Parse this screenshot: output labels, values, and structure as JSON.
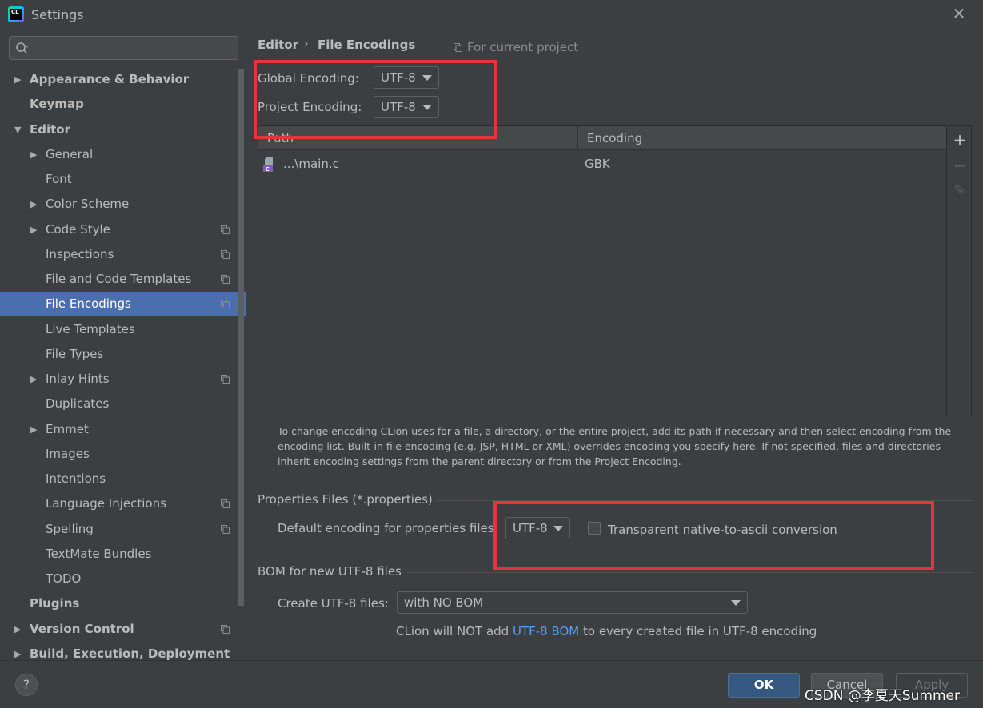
{
  "window": {
    "title": "Settings",
    "app_icon_text": "CL",
    "close_glyph": "✕"
  },
  "search": {
    "value": "",
    "placeholder": ""
  },
  "sidebar": {
    "items": [
      {
        "label": "Appearance & Behavior",
        "level": 0,
        "bold": true,
        "expandable": true,
        "expanded": false,
        "project_icon": false,
        "selected": false
      },
      {
        "label": "Keymap",
        "level": 0,
        "bold": true,
        "expandable": false,
        "project_icon": false,
        "selected": false
      },
      {
        "label": "Editor",
        "level": 0,
        "bold": true,
        "expandable": true,
        "expanded": true,
        "project_icon": false,
        "selected": false
      },
      {
        "label": "General",
        "level": 1,
        "bold": false,
        "expandable": true,
        "expanded": false,
        "project_icon": false,
        "selected": false
      },
      {
        "label": "Font",
        "level": 1,
        "bold": false,
        "expandable": false,
        "project_icon": false,
        "selected": false
      },
      {
        "label": "Color Scheme",
        "level": 1,
        "bold": false,
        "expandable": true,
        "expanded": false,
        "project_icon": false,
        "selected": false
      },
      {
        "label": "Code Style",
        "level": 1,
        "bold": false,
        "expandable": true,
        "expanded": false,
        "project_icon": true,
        "selected": false
      },
      {
        "label": "Inspections",
        "level": 1,
        "bold": false,
        "expandable": false,
        "project_icon": true,
        "selected": false
      },
      {
        "label": "File and Code Templates",
        "level": 1,
        "bold": false,
        "expandable": false,
        "project_icon": true,
        "selected": false
      },
      {
        "label": "File Encodings",
        "level": 1,
        "bold": false,
        "expandable": false,
        "project_icon": true,
        "selected": true
      },
      {
        "label": "Live Templates",
        "level": 1,
        "bold": false,
        "expandable": false,
        "project_icon": false,
        "selected": false
      },
      {
        "label": "File Types",
        "level": 1,
        "bold": false,
        "expandable": false,
        "project_icon": false,
        "selected": false
      },
      {
        "label": "Inlay Hints",
        "level": 1,
        "bold": false,
        "expandable": true,
        "expanded": false,
        "project_icon": true,
        "selected": false
      },
      {
        "label": "Duplicates",
        "level": 1,
        "bold": false,
        "expandable": false,
        "project_icon": false,
        "selected": false
      },
      {
        "label": "Emmet",
        "level": 1,
        "bold": false,
        "expandable": true,
        "expanded": false,
        "project_icon": false,
        "selected": false
      },
      {
        "label": "Images",
        "level": 1,
        "bold": false,
        "expandable": false,
        "project_icon": false,
        "selected": false
      },
      {
        "label": "Intentions",
        "level": 1,
        "bold": false,
        "expandable": false,
        "project_icon": false,
        "selected": false
      },
      {
        "label": "Language Injections",
        "level": 1,
        "bold": false,
        "expandable": false,
        "project_icon": true,
        "selected": false
      },
      {
        "label": "Spelling",
        "level": 1,
        "bold": false,
        "expandable": false,
        "project_icon": true,
        "selected": false
      },
      {
        "label": "TextMate Bundles",
        "level": 1,
        "bold": false,
        "expandable": false,
        "project_icon": false,
        "selected": false
      },
      {
        "label": "TODO",
        "level": 1,
        "bold": false,
        "expandable": false,
        "project_icon": false,
        "selected": false
      },
      {
        "label": "Plugins",
        "level": 0,
        "bold": true,
        "expandable": false,
        "project_icon": false,
        "selected": false
      },
      {
        "label": "Version Control",
        "level": 0,
        "bold": true,
        "expandable": true,
        "expanded": false,
        "project_icon": true,
        "selected": false
      },
      {
        "label": "Build, Execution, Deployment",
        "level": 0,
        "bold": true,
        "expandable": true,
        "expanded": false,
        "project_icon": false,
        "selected": false
      }
    ]
  },
  "breadcrumb": {
    "parent": "Editor",
    "separator": "›",
    "current": "File Encodings",
    "scope": "For current project"
  },
  "encodings": {
    "global_label": "Global Encoding:",
    "global_value": "UTF-8",
    "project_label": "Project Encoding:",
    "project_value": "UTF-8"
  },
  "table": {
    "columns": [
      "Path",
      "Encoding"
    ],
    "rows": [
      {
        "path": "...\\main.c",
        "encoding": "GBK"
      }
    ],
    "toolbar": {
      "add": "+",
      "remove": "−",
      "edit": "✎"
    }
  },
  "help_text": "To change encoding CLion uses for a file, a directory, or the entire project, add its path if necessary and then select encoding from the encoding list. Built-in file encoding (e.g. JSP, HTML or XML) overrides encoding you specify here. If not specified, files and directories inherit encoding settings from the parent directory or from the Project Encoding.",
  "properties": {
    "section_title": "Properties Files (*.properties)",
    "default_label": "Default encoding for properties files:",
    "default_value": "UTF-8",
    "transparent_label": "Transparent native-to-ascii conversion",
    "transparent_checked": false
  },
  "bom": {
    "section_title": "BOM for new UTF-8 files",
    "create_label": "Create UTF-8 files:",
    "create_value": "with NO BOM",
    "note_prefix": "CLion will NOT add ",
    "note_link": "UTF-8 BOM",
    "note_suffix": " to every created file in UTF-8 encoding"
  },
  "buttons": {
    "help": "?",
    "ok": "OK",
    "cancel": "Cancel",
    "apply": "Apply"
  },
  "watermark": "CSDN @李夏天Summer",
  "colors": {
    "background": "#3c3f41",
    "selection": "#4b6eaf",
    "highlight_box": "#e8323c",
    "link": "#589df6",
    "ok_button": "#365880"
  }
}
